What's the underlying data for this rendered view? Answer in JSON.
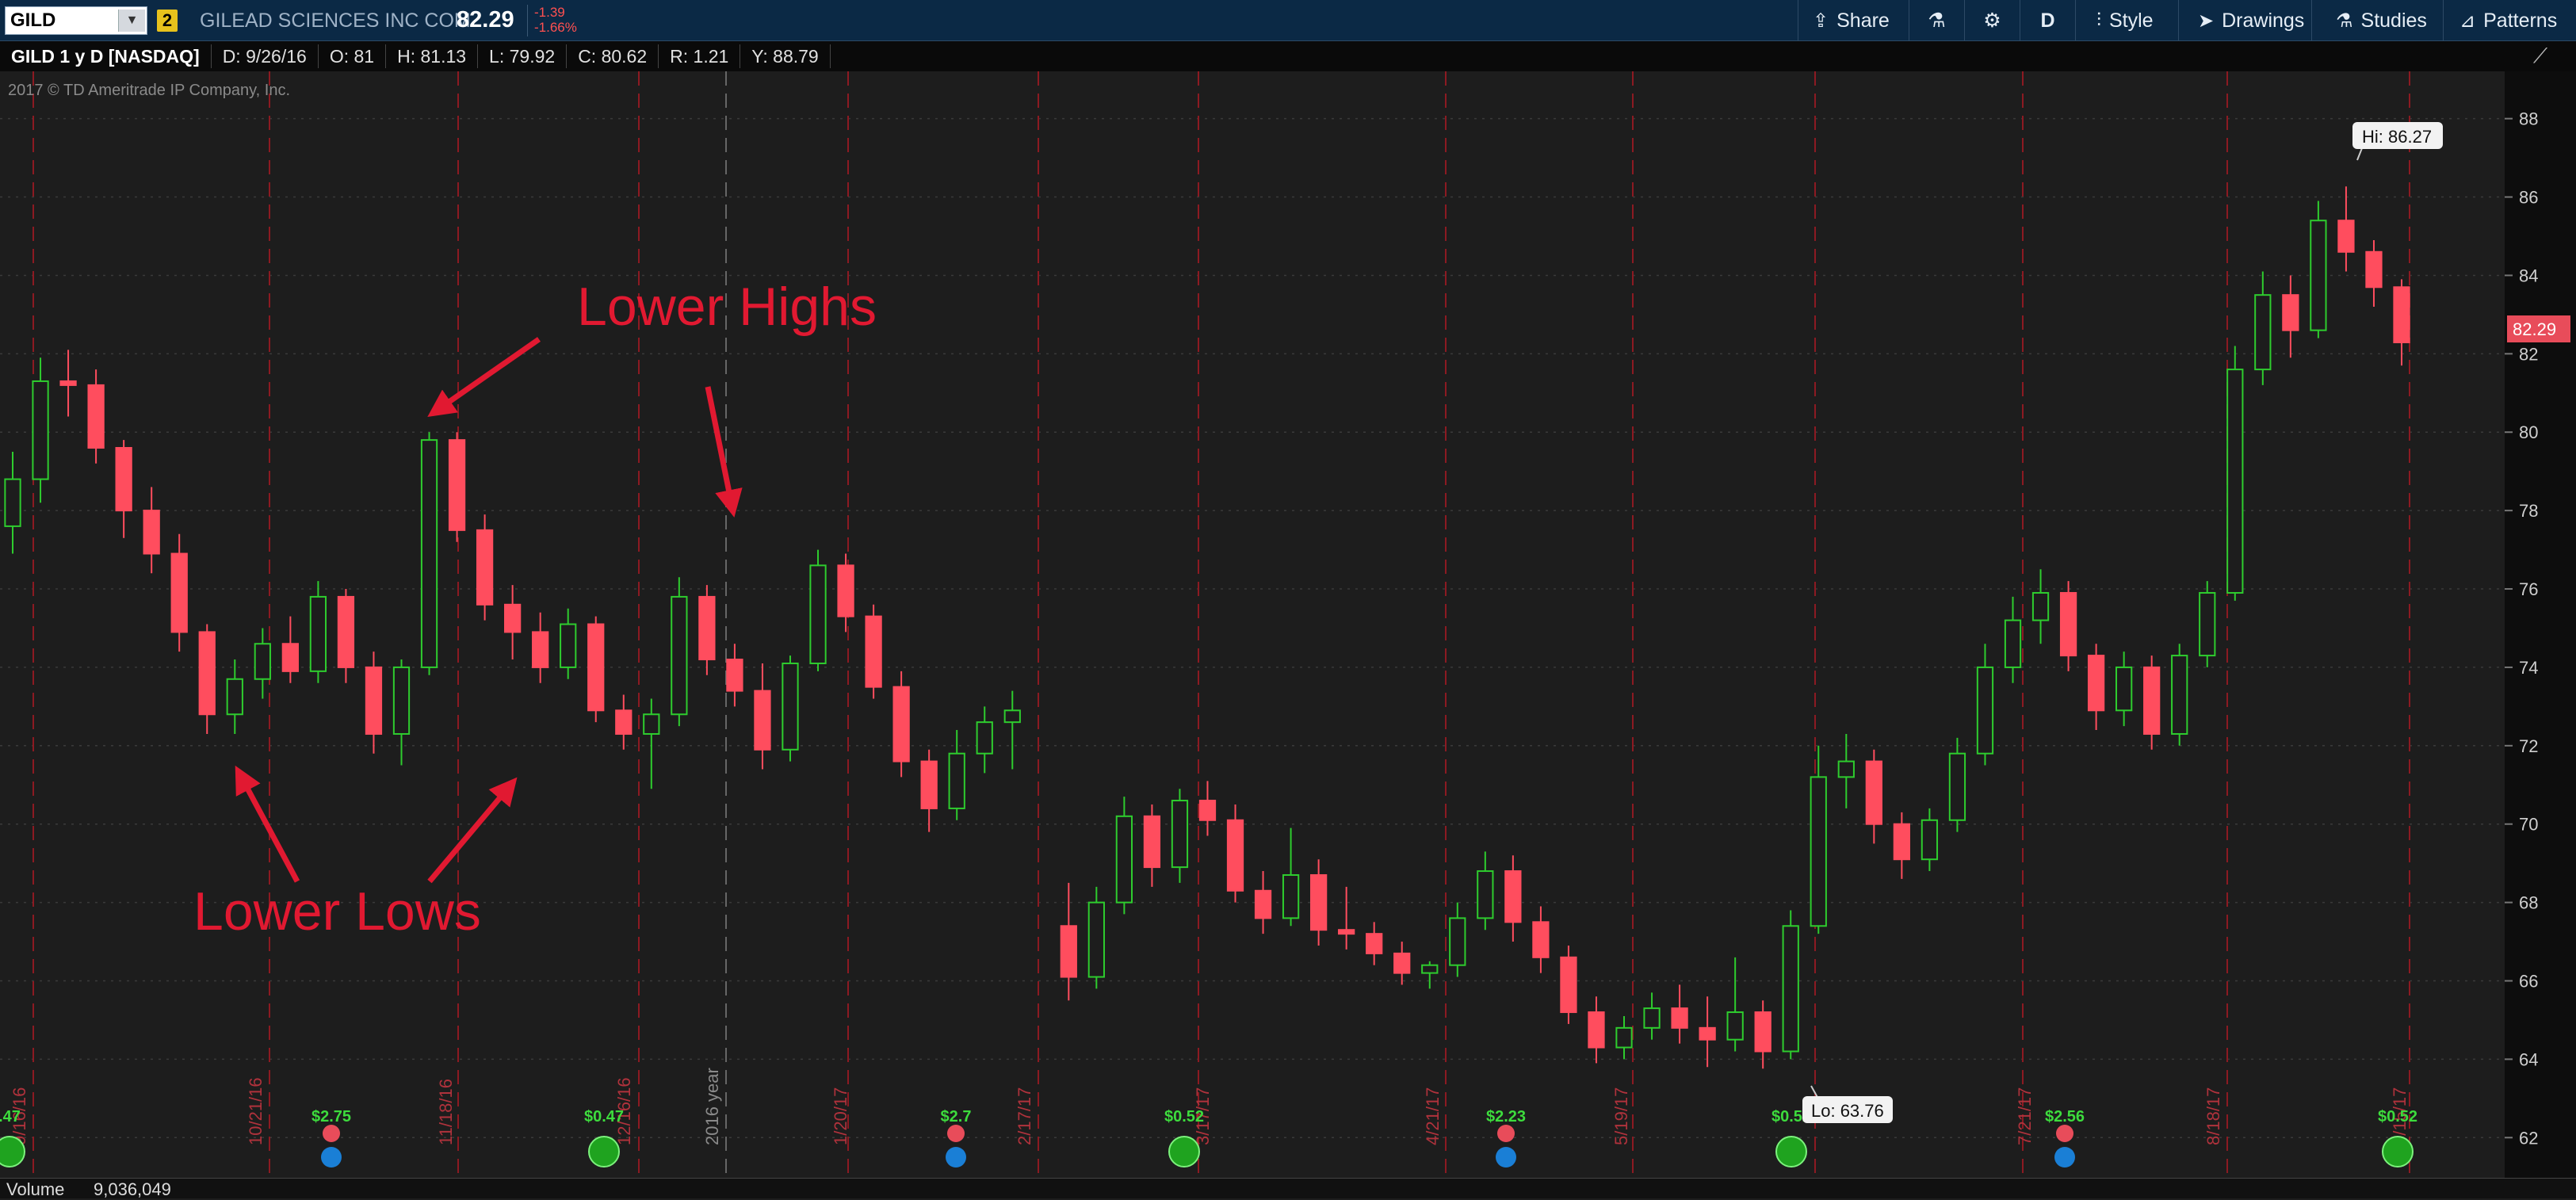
{
  "toolbar": {
    "symbol": "GILD",
    "link_badge": "2",
    "company": "GILEAD SCIENCES INC COM",
    "last_price": "82.29",
    "change": "-1.39",
    "change_pct": "-1.66%",
    "share_label": "Share",
    "period_label": "D",
    "style_label": "Style",
    "drawings_label": "Drawings",
    "studies_label": "Studies",
    "patterns_label": "Patterns",
    "icons": {
      "share": "share-icon",
      "flask": "flask-icon",
      "settings": "gear-icon",
      "style": "candle-style-icon",
      "drawings": "cursor-arrow-icon",
      "studies": "flask-icon",
      "patterns": "patterns-icon"
    }
  },
  "infobar": {
    "title": "GILD 1 y D [NASDAQ]",
    "date": "D: 9/26/16",
    "open": "O:  81",
    "high": "H:  81.13",
    "low": "L:  79.92",
    "close": "C:  80.62",
    "range": "R:  1.21",
    "y": "Y:  88.79"
  },
  "bottom": {
    "volume_label": "Volume",
    "volume_value": "9,036,049"
  },
  "chart_data": {
    "type": "candlestick",
    "symbol": "GILD",
    "exchange": "NASDAQ",
    "copyright": "2017 © TD Ameritrade IP Company, Inc.",
    "ylim": [
      61.5,
      88.6
    ],
    "y_ticks": [
      62,
      64,
      66,
      68,
      70,
      72,
      74,
      76,
      78,
      80,
      82,
      84,
      86,
      88
    ],
    "current_price_label": "82.29",
    "high_marker": "Hi: 86.27",
    "low_marker": "Lo: 63.76",
    "x_date_labels": [
      "9/16/16",
      "10/21/16",
      "11/18/16",
      "12/16/16",
      "2016 year",
      "1/20/17",
      "2/17/17",
      "3/17/17",
      "4/21/17",
      "5/19/17",
      "7/21/17",
      "8/18/17",
      "9/15/17"
    ],
    "events": [
      {
        "type": "dividend",
        "label": ".47"
      },
      {
        "type": "earnings",
        "label": "$2.75"
      },
      {
        "type": "dividend",
        "label": "$0.47"
      },
      {
        "type": "earnings",
        "label": "$2.7"
      },
      {
        "type": "dividend",
        "label": "$0.52"
      },
      {
        "type": "earnings",
        "label": "$2.23"
      },
      {
        "type": "dividend",
        "label": "$0.52"
      },
      {
        "type": "earnings",
        "label": "$2.56"
      },
      {
        "type": "dividend",
        "label": "$0.52"
      }
    ],
    "annotations": [
      {
        "text": "Lower Highs"
      },
      {
        "text": "Lower Lows"
      }
    ],
    "ohlc_path": [
      [
        77.6,
        79.5,
        76.9,
        78.8
      ],
      [
        78.8,
        81.9,
        78.2,
        81.3
      ],
      [
        81.3,
        82.1,
        80.4,
        81.2
      ],
      [
        81.2,
        81.6,
        79.2,
        79.6
      ],
      [
        79.6,
        79.8,
        77.3,
        78.0
      ],
      [
        78.0,
        78.6,
        76.4,
        76.9
      ],
      [
        76.9,
        77.4,
        74.4,
        74.9
      ],
      [
        74.9,
        75.1,
        72.3,
        72.8
      ],
      [
        72.8,
        74.2,
        72.3,
        73.7
      ],
      [
        73.7,
        75.0,
        73.2,
        74.6
      ],
      [
        74.6,
        75.3,
        73.6,
        73.9
      ],
      [
        73.9,
        76.2,
        73.6,
        75.8
      ],
      [
        75.8,
        76.0,
        73.6,
        74.0
      ],
      [
        74.0,
        74.4,
        71.8,
        72.3
      ],
      [
        72.3,
        74.2,
        71.5,
        74.0
      ],
      [
        74.0,
        80.0,
        73.8,
        79.8
      ],
      [
        79.8,
        80.0,
        77.2,
        77.5
      ],
      [
        77.5,
        77.9,
        75.2,
        75.6
      ],
      [
        75.6,
        76.1,
        74.2,
        74.9
      ],
      [
        74.9,
        75.4,
        73.6,
        74.0
      ],
      [
        74.0,
        75.5,
        73.7,
        75.1
      ],
      [
        75.1,
        75.3,
        72.6,
        72.9
      ],
      [
        72.9,
        73.3,
        71.9,
        72.3
      ],
      [
        72.3,
        73.2,
        70.9,
        72.8
      ],
      [
        72.8,
        76.3,
        72.5,
        75.8
      ],
      [
        75.8,
        76.1,
        73.8,
        74.2
      ],
      [
        74.2,
        74.6,
        73.0,
        73.4
      ],
      [
        73.4,
        74.1,
        71.4,
        71.9
      ],
      [
        71.9,
        74.3,
        71.6,
        74.1
      ],
      [
        74.1,
        77.0,
        73.9,
        76.6
      ],
      [
        76.6,
        76.9,
        74.9,
        75.3
      ],
      [
        75.3,
        75.6,
        73.2,
        73.5
      ],
      [
        73.5,
        73.9,
        71.2,
        71.6
      ],
      [
        71.6,
        71.9,
        69.8,
        70.4
      ],
      [
        70.4,
        72.4,
        70.1,
        71.8
      ],
      [
        71.8,
        73.0,
        71.3,
        72.6
      ],
      [
        72.6,
        73.4,
        71.4,
        72.9
      ],
      [
        67.4,
        68.5,
        65.5,
        66.1
      ],
      [
        66.1,
        68.4,
        65.8,
        68.0
      ],
      [
        68.0,
        70.7,
        67.7,
        70.2
      ],
      [
        70.2,
        70.5,
        68.4,
        68.9
      ],
      [
        68.9,
        70.9,
        68.5,
        70.6
      ],
      [
        70.6,
        71.1,
        69.7,
        70.1
      ],
      [
        70.1,
        70.5,
        68.0,
        68.3
      ],
      [
        68.3,
        68.8,
        67.2,
        67.6
      ],
      [
        67.6,
        69.9,
        67.4,
        68.7
      ],
      [
        68.7,
        69.1,
        66.9,
        67.3
      ],
      [
        67.3,
        68.4,
        66.8,
        67.2
      ],
      [
        67.2,
        67.5,
        66.4,
        66.7
      ],
      [
        66.7,
        67.0,
        65.9,
        66.2
      ],
      [
        66.2,
        66.5,
        65.8,
        66.4
      ],
      [
        66.4,
        68.0,
        66.1,
        67.6
      ],
      [
        67.6,
        69.3,
        67.3,
        68.8
      ],
      [
        68.8,
        69.2,
        67.0,
        67.5
      ],
      [
        67.5,
        67.9,
        66.2,
        66.6
      ],
      [
        66.6,
        66.9,
        64.9,
        65.2
      ],
      [
        65.2,
        65.6,
        63.9,
        64.3
      ],
      [
        64.3,
        65.1,
        64.0,
        64.8
      ],
      [
        64.8,
        65.7,
        64.5,
        65.3
      ],
      [
        65.3,
        65.9,
        64.4,
        64.8
      ],
      [
        64.8,
        65.6,
        63.8,
        64.5
      ],
      [
        64.5,
        66.6,
        64.2,
        65.2
      ],
      [
        65.2,
        65.5,
        63.76,
        64.2
      ],
      [
        64.2,
        67.8,
        64.0,
        67.4
      ],
      [
        67.4,
        72.0,
        67.2,
        71.2
      ],
      [
        71.2,
        72.3,
        70.4,
        71.6
      ],
      [
        71.6,
        71.9,
        69.5,
        70.0
      ],
      [
        70.0,
        70.3,
        68.6,
        69.1
      ],
      [
        69.1,
        70.4,
        68.8,
        70.1
      ],
      [
        70.1,
        72.2,
        69.8,
        71.8
      ],
      [
        71.8,
        74.6,
        71.5,
        74.0
      ],
      [
        74.0,
        75.8,
        73.6,
        75.2
      ],
      [
        75.2,
        76.5,
        74.6,
        75.9
      ],
      [
        75.9,
        76.2,
        73.9,
        74.3
      ],
      [
        74.3,
        74.6,
        72.4,
        72.9
      ],
      [
        72.9,
        74.4,
        72.5,
        74.0
      ],
      [
        74.0,
        74.3,
        71.9,
        72.3
      ],
      [
        72.3,
        74.6,
        72.0,
        74.3
      ],
      [
        74.3,
        76.2,
        74.0,
        75.9
      ],
      [
        75.9,
        82.2,
        75.7,
        81.6
      ],
      [
        81.6,
        84.1,
        81.2,
        83.5
      ],
      [
        83.5,
        84.0,
        81.9,
        82.6
      ],
      [
        82.6,
        85.9,
        82.4,
        85.4
      ],
      [
        85.4,
        86.27,
        84.1,
        84.6
      ],
      [
        84.6,
        84.9,
        83.2,
        83.7
      ],
      [
        83.7,
        83.9,
        81.7,
        82.29
      ]
    ]
  }
}
